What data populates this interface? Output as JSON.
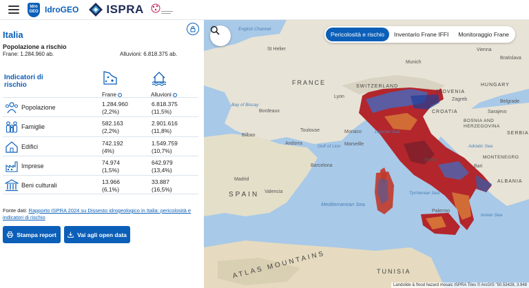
{
  "header": {
    "brand_badge": "Idro GEO",
    "brand_name": "IdroGEO",
    "ispra": "ISPRA"
  },
  "panel": {
    "title": "Italia",
    "subtitle": "Popolazione a rischio",
    "frane_pop": "Frane: 1.284.960 ab.",
    "alluv_pop": "Alluvioni: 6.818.375 ab.",
    "indicators_title": "Indicatori di rischio",
    "col_frane": "Frane",
    "col_alluvioni": "Alluvioni",
    "rows": [
      {
        "name": "Popolazione",
        "icon": "population-icon",
        "frane": "1.284.960",
        "frane_pct": "(2,2%)",
        "alluv": "6.818.375",
        "alluv_pct": "(11,5%)"
      },
      {
        "name": "Famiglie",
        "icon": "family-icon",
        "frane": "582.163",
        "frane_pct": "(2,2%)",
        "alluv": "2.901.616",
        "alluv_pct": "(11,8%)"
      },
      {
        "name": "Edifici",
        "icon": "building-icon",
        "frane": "742.192",
        "frane_pct": "(4%)",
        "alluv": "1.549.759",
        "alluv_pct": "(10,7%)"
      },
      {
        "name": "Imprese",
        "icon": "factory-icon",
        "frane": "74.974",
        "frane_pct": "(1,5%)",
        "alluv": "642.979",
        "alluv_pct": "(13,4%)"
      },
      {
        "name": "Beni culturali",
        "icon": "heritage-icon",
        "frane": "13.966",
        "frane_pct": "(6,1%)",
        "alluv": "33.887",
        "alluv_pct": "(16,5%)"
      }
    ],
    "source_prefix": "Fonte dati: ",
    "source_link": "Rapporto ISPRA 2024 su Dissesto idrogeologico in Italia: pericolosità e indicatori di rischio",
    "btn_report": "Stampa report",
    "btn_open": "Vai agli open data"
  },
  "map": {
    "tabs": [
      "Pericolosità e rischio",
      "Inventario Frane IFFI",
      "Monitoraggio Frane"
    ],
    "active_tab": 0,
    "attribution": "Landslide & flood hazard mosaic ISPRA Tiles © ArcGIS    \"50.53428, 3.948",
    "labels": {
      "english_channel": "English Channel",
      "st_helier": "St Helier",
      "munich": "Munich",
      "vienna": "Vienna",
      "bratislava": "Bratislava",
      "france": "FRANCE",
      "switzerland": "SWITZERLAND",
      "slovenia": "SLOVENIA",
      "hungary": "HUNGARY",
      "croatia": "CROATIA",
      "bosnia": "BOSNIA AND HERZEGOVINA",
      "serbia": "SERBIA",
      "lyon": "Lyon",
      "zagreb": "Zagreb",
      "bay_of_biscay": "Bay of Biscay",
      "bordeaux": "Bordeaux",
      "toulouse": "Toulouse",
      "monaco": "Monaco",
      "marseille": "Marseille",
      "ligurian_sea": "Ligurian Sea",
      "gulf_of_lion": "Gulf of Lion",
      "adriatic_sea": "Adriatic Sea",
      "bilbao": "Bilbao",
      "andorra": "Andorra",
      "barcelona": "Barcelona",
      "madrid": "Madrid",
      "spain": "SPAIN",
      "valencia": "Valencia",
      "tyrrhenian_sea": "Tyrrhenian Sea",
      "mediterranean_sea": "Mediterranean Sea",
      "bari": "Bari",
      "albania": "ALBANIA",
      "palermo": "Palermo",
      "ionian_sea": "Ionian Sea",
      "tunisia": "TUNISIA",
      "atlas": "ATLAS MOUNTAINS",
      "montenegro": "MONTENEGRO",
      "rome": "Rome",
      "sarajevo": "Sarajevo",
      "belgrade": "Belgrade"
    }
  }
}
